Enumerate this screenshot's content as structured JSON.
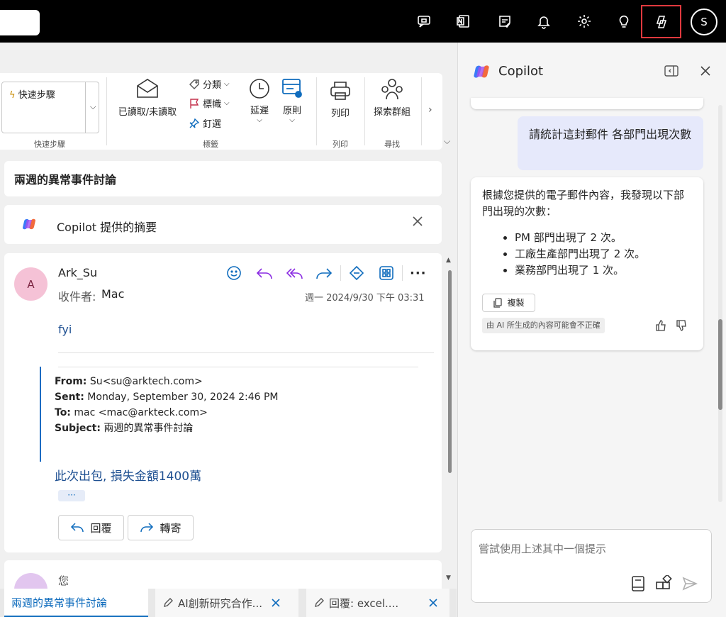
{
  "topbar": {
    "icons": [
      "chat-feedback-icon",
      "onenote-icon",
      "todo-icon",
      "bell-icon",
      "gear-icon",
      "lightbulb-icon",
      "copilot-icon"
    ],
    "avatar_initial": "S"
  },
  "ribbon": {
    "quick_steps_label": "快速步驟",
    "quick_steps_group": "快速步驟",
    "read_unread": "已讀取/未讀取",
    "categorize": "分類",
    "flag": "標幟",
    "pin": "釘選",
    "snooze": "延遲",
    "rules": "原則",
    "tags_group": "標籤",
    "print": "列印",
    "print_group": "列印",
    "discover_groups": "探索群組",
    "find_group": "尋找"
  },
  "message": {
    "subject": "兩週的異常事件討論",
    "summary_label": "Copilot 提供的摘要",
    "sender_initial": "A",
    "sender_name": "Ark_Su",
    "to_label": "收件者:",
    "to_name": "Mac",
    "date": "週一 2024/9/30 下午 03:31",
    "body_intro": "fyi",
    "from_label": "From:",
    "from_value": " Su<su@arktech.com>",
    "sent_label": "Sent:",
    "sent_value": " Monday, September 30, 2024 2:46 PM",
    "to2_label": "To:",
    "to2_value": " mac <mac@arkteck.com>",
    "subject_label": "Subject:",
    "subject_value": " 兩週的異常事件討論",
    "body_text": "此次出包, 損失金額1400萬",
    "ellipsis": "···",
    "reply_label": "回覆",
    "forward_label": "轉寄",
    "next_sender": "您"
  },
  "tabs": [
    {
      "label": "兩週的異常事件討論"
    },
    {
      "label": "AI創新研究合作..."
    },
    {
      "label": "回覆: excel...."
    }
  ],
  "copilot": {
    "title": "Copilot",
    "user_prompt": "請統計這封郵件 各部門出現次數",
    "ai_intro": "根據您提供的電子郵件內容，我發現以下部門出現的次數：",
    "ai_items": [
      "PM 部門出現了 2 次。",
      "工廠生產部門出現了 2 次。",
      "業務部門出現了 1 次。"
    ],
    "copy_label": "複製",
    "disclaimer": "由 AI 所生成的內容可能會不正確",
    "input_placeholder": "嘗試使用上述其中一個提示"
  },
  "colors": {
    "accent": "#0f6cbd",
    "link_blue": "#1d4f91",
    "highlight_red": "#e0393e"
  }
}
